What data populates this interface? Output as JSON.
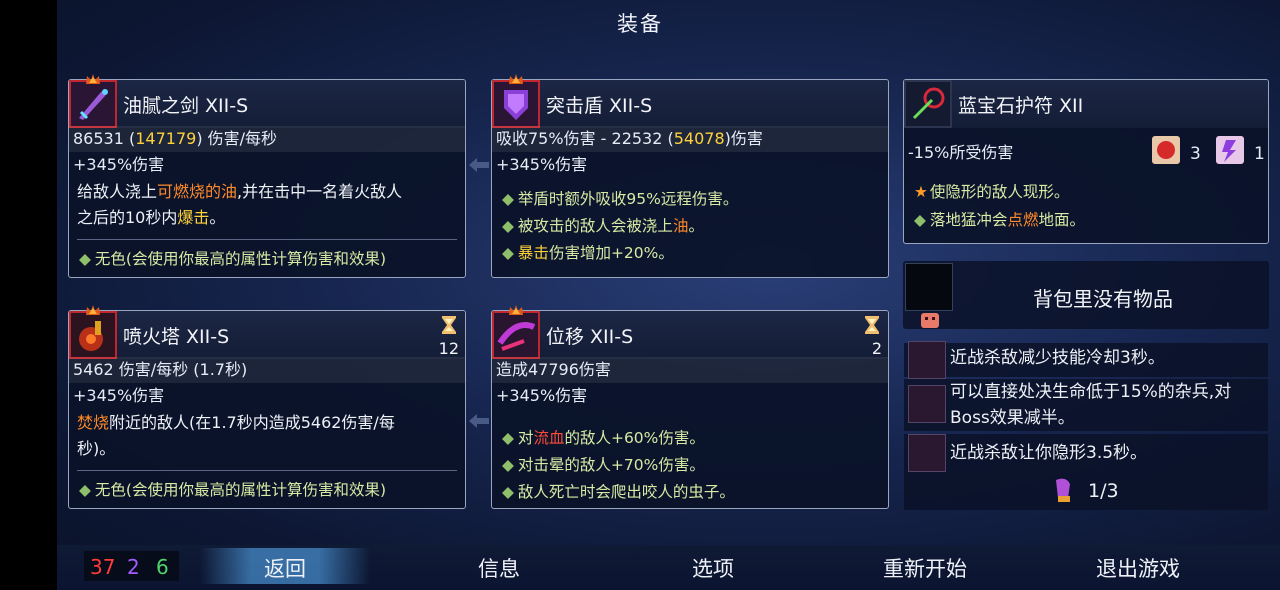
{
  "screen": {
    "title": "装备"
  },
  "weapon1": {
    "name": "油腻之剑 XII-S",
    "stat_dps": "86531",
    "stat_dps_bonus": "147179",
    "stat_suffix": "伤害/每秒",
    "stat_bonus": "+345%伤害",
    "desc_pre": "给敌人浇上",
    "desc_hl": "可燃烧的油",
    "desc_post": ",并在击中一名着火敌人",
    "desc_line2_pre": "之后的10秒内",
    "desc_line2_hl": "爆击",
    "desc_line2_post": "。",
    "affix": "无色(会使用你最高的属性计算伤害和效果)"
  },
  "weapon2": {
    "name": "突击盾 XII-S",
    "stat_line_pre": "吸收75%伤害 - 22532 (",
    "stat_line_bonus": "54078",
    "stat_line_post": ")伤害",
    "stat_bonus": "+345%伤害",
    "mod1": "举盾时额外吸收95%远程伤害。",
    "mod2_pre": "被攻击的敌人会被浇上",
    "mod2_hl": "油",
    "mod2_post": "。",
    "mod3_hl": "暴击",
    "mod3_post": "伤害增加+20%。"
  },
  "amulet": {
    "name": "蓝宝石护符 XII",
    "stat": "-15%所受伤害",
    "scroll_red_count": "3",
    "scroll_purple_count": "1",
    "mod1": "使隐形的敌人现形。",
    "mod2_pre": "落地猛冲会",
    "mod2_hl": "点燃",
    "mod2_post": "地面。"
  },
  "skill1": {
    "name": "喷火塔 XII-S",
    "cooldown": "12",
    "stat": "5462 伤害/每秒 (1.7秒)",
    "stat_bonus": "+345%伤害",
    "desc_hl": "焚烧",
    "desc_post": "附近的敌人(在1.7秒内造成5462伤害/每",
    "desc_line2": "秒)。",
    "affix": "无色(会使用你最高的属性计算伤害和效果)"
  },
  "skill2": {
    "name": "位移 XII-S",
    "cooldown": "2",
    "stat": "造成47796伤害",
    "stat_bonus": "+345%伤害",
    "mod1_pre": "对",
    "mod1_hl": "流血",
    "mod1_post": "的敌人+60%伤害。",
    "mod2": "对击晕的敌人+70%伤害。",
    "mod3": "敌人死亡时会爬出咬人的虫子。"
  },
  "backpack": {
    "empty_label": "背包里没有物品"
  },
  "mutations": {
    "items": [
      {
        "text": "近战杀敌减少技能冷却3秒。"
      },
      {
        "text_line1": "可以直接处决生命低于15%的杂兵,对",
        "text_line2": "Boss效果减半。"
      },
      {
        "text": "近战杀敌让你隐形3.5秒。"
      }
    ],
    "count": "1/3"
  },
  "stats": {
    "brutality": "37",
    "tactics": "2",
    "survival": "6",
    "brutality_color": "#ff3b3b",
    "tactics_color": "#a45cff",
    "survival_color": "#4fd36a"
  },
  "menu": {
    "back": "返回",
    "info": "信息",
    "options": "选项",
    "restart": "重新开始",
    "quit": "退出游戏"
  }
}
